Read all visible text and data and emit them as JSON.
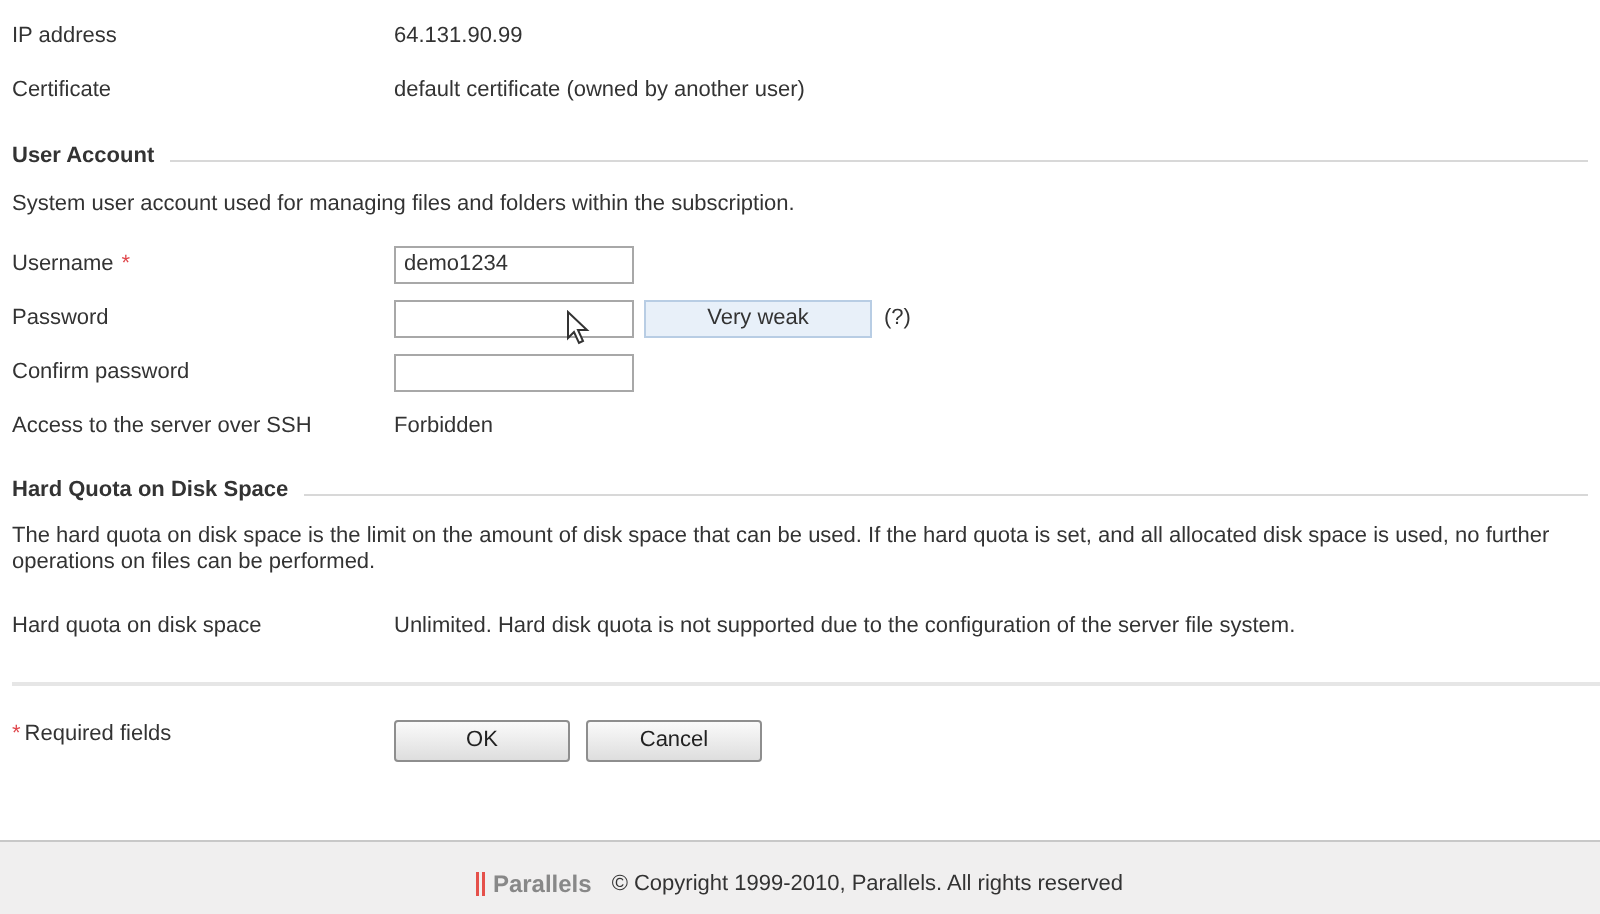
{
  "top_rows": [
    {
      "label": "IP address",
      "value": "64.131.90.99"
    },
    {
      "label": "Certificate",
      "value": "default certificate (owned by another user)"
    }
  ],
  "user_account": {
    "heading": "User Account",
    "description": "System user account used for managing files and folders within the subscription.",
    "username": {
      "label": "Username",
      "required_mark": "*",
      "value": "demo1234"
    },
    "password": {
      "label": "Password",
      "strength": "Very weak",
      "help": "(?)"
    },
    "confirm_password": {
      "label": "Confirm password"
    },
    "ssh": {
      "label": "Access to the server over SSH",
      "value": "Forbidden"
    }
  },
  "hard_quota": {
    "heading": "Hard Quota on Disk Space",
    "description": "The hard quota on disk space is the limit on the amount of disk space that can be used. If the hard quota is set, and all allocated disk space is used, no further operations on files can be performed.",
    "label": "Hard quota on disk space",
    "value": "Unlimited. Hard disk quota is not supported due to the configuration of the server file system."
  },
  "required_note": {
    "mark": "*",
    "text": "Required fields"
  },
  "buttons": [
    "OK",
    "Cancel"
  ],
  "footer": {
    "logo": "Parallels",
    "copyright": "© Copyright 1999-2010, Parallels. All rights reserved"
  }
}
